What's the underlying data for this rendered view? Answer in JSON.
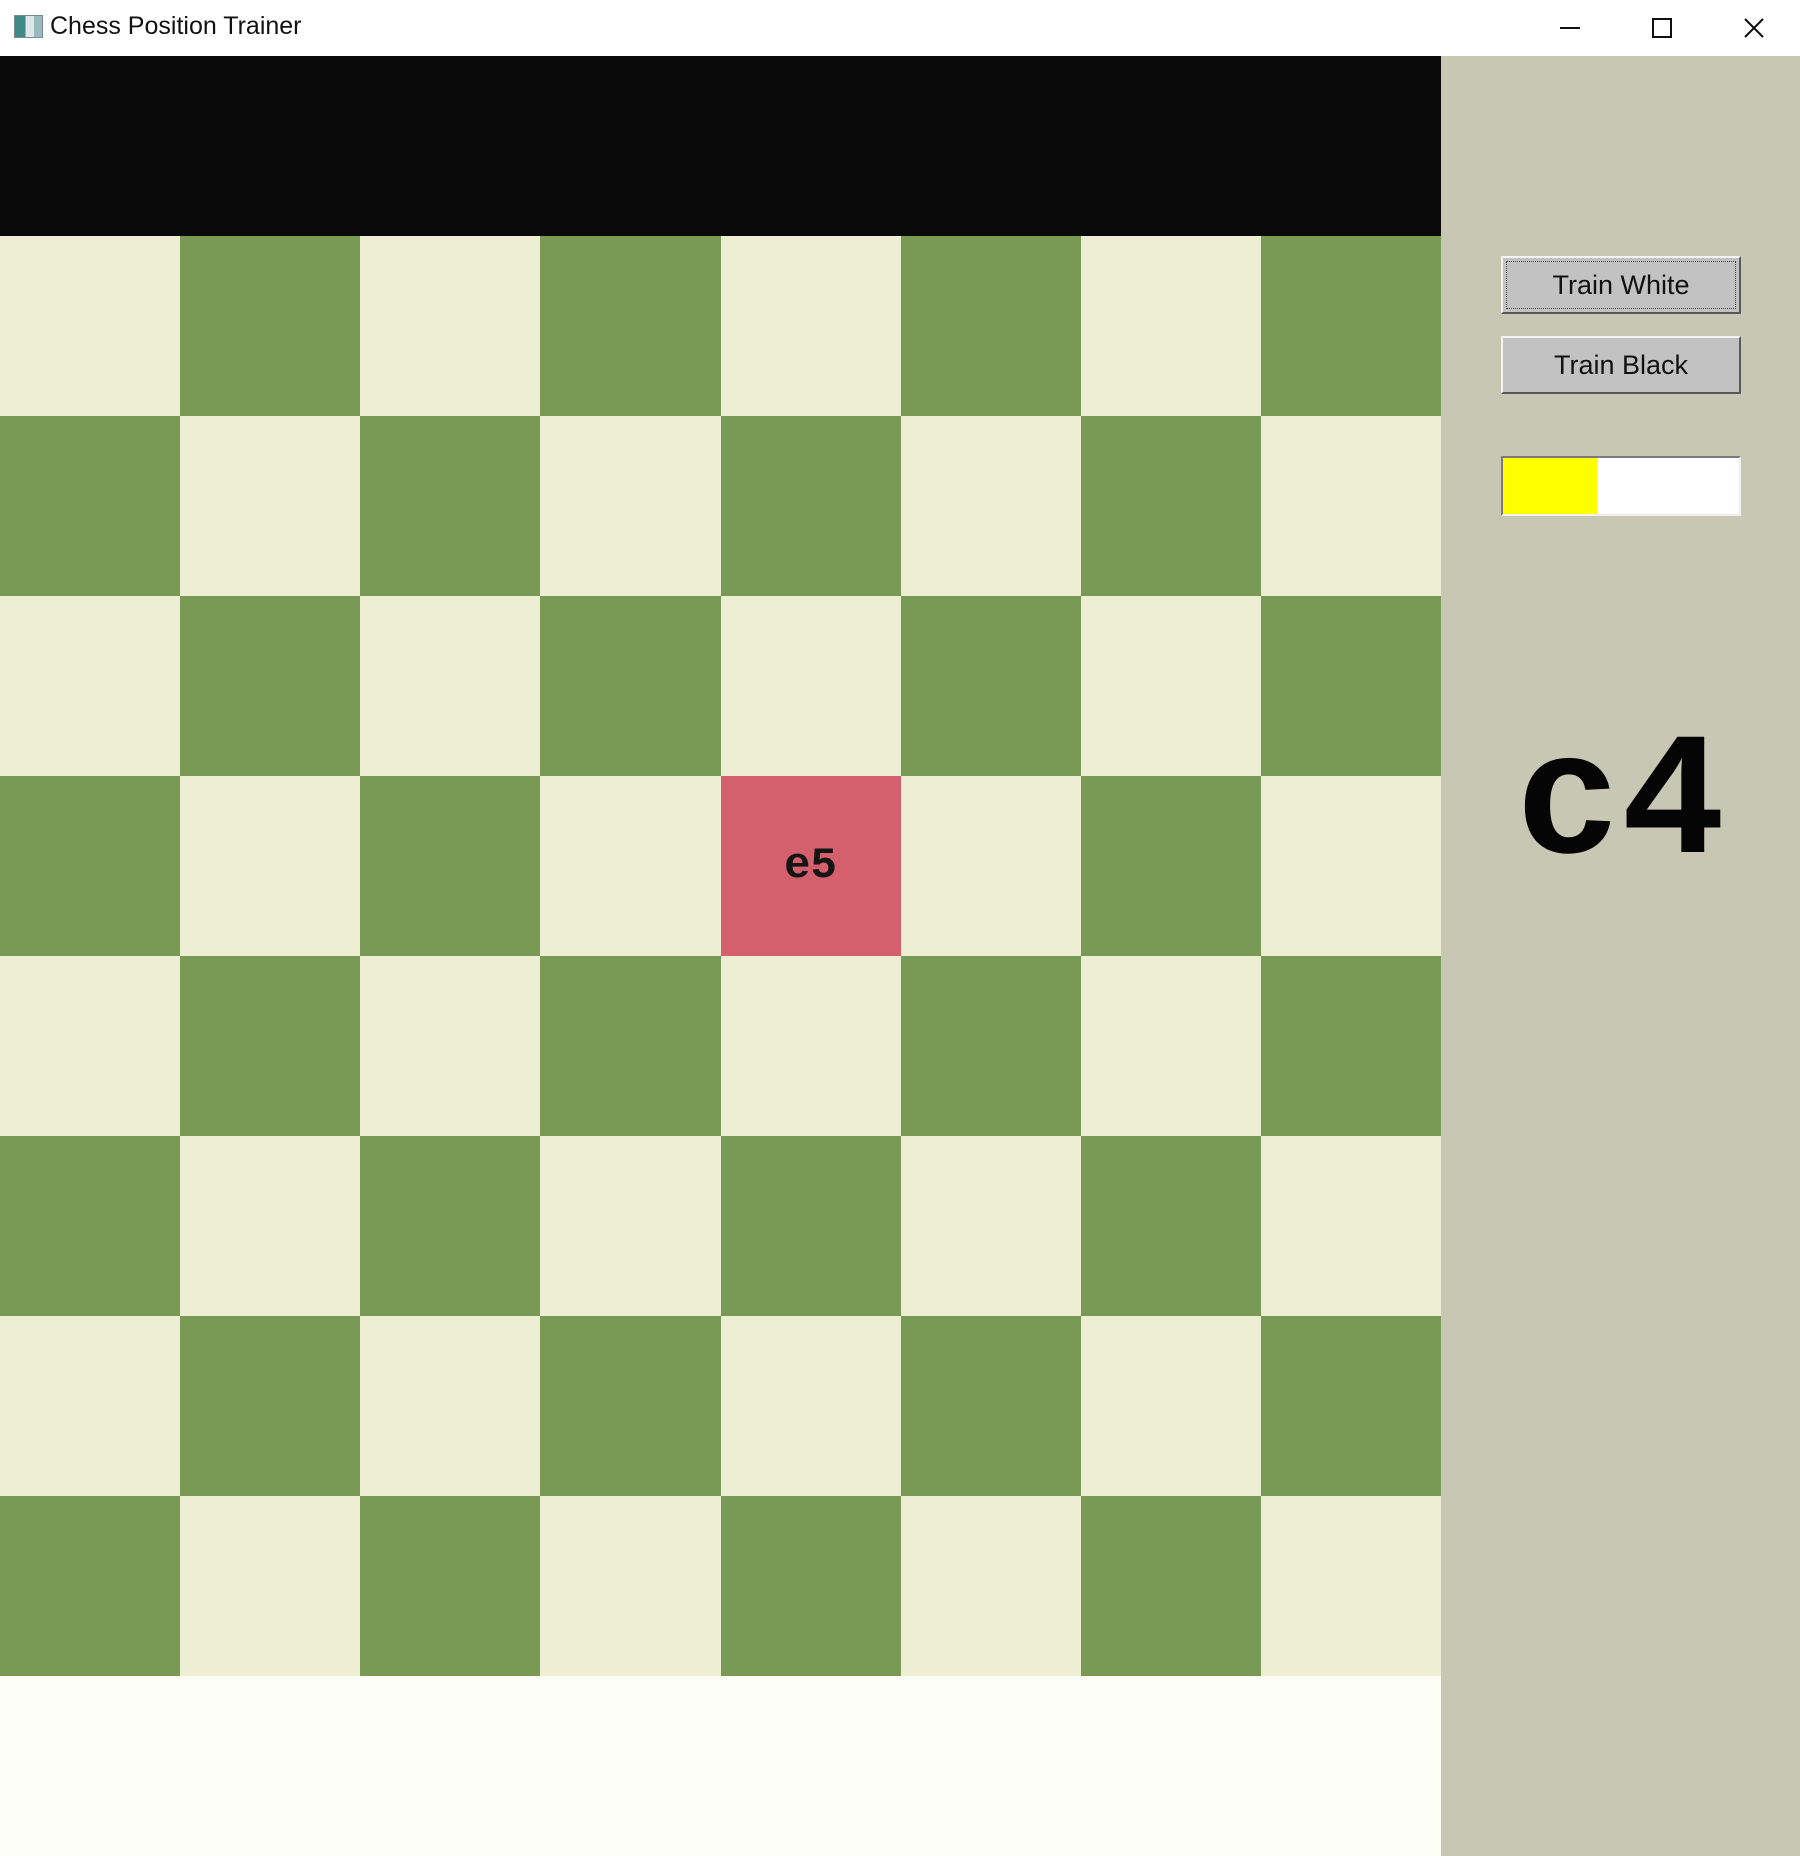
{
  "window": {
    "title": "Chess Position Trainer",
    "icons": {
      "app": "app-icon",
      "minimize": "minimize-icon",
      "maximize": "maximize-icon",
      "close": "close-icon"
    }
  },
  "board": {
    "colors": {
      "light": "#eeeed4",
      "dark": "#789a55",
      "highlight": "#d3606c",
      "top_strip": "#0a0a0a",
      "bottom_strip": "#fcfdf5"
    },
    "highlighted_square": {
      "row": 3,
      "col": 4,
      "label": "e5"
    }
  },
  "panel": {
    "background": "#c8c7b3",
    "train_white_label": "Train White",
    "train_black_label": "Train Black",
    "progress": {
      "fraction": 0.4,
      "color": "#ffff00"
    },
    "target_square": "c4"
  }
}
